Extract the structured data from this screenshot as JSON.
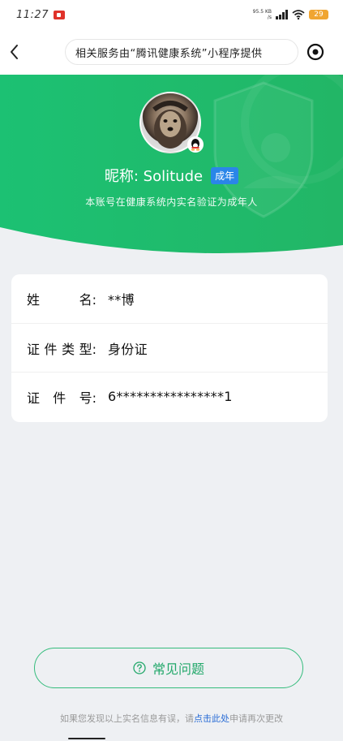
{
  "status_bar": {
    "time": "11:27",
    "net_speed_top": "95.5 KB",
    "net_speed_bottom": "/s",
    "battery": "29"
  },
  "nav": {
    "notice": "相关服务由“腾讯健康系统”小程序提供"
  },
  "profile": {
    "nickname": "昵称: Solitude",
    "badge": "成年",
    "verify_text": "本账号在健康系统内实名验证为成年人"
  },
  "info": {
    "rows": [
      {
        "label": [
          "姓",
          "名:"
        ],
        "value": "**博"
      },
      {
        "label": [
          "证",
          "件",
          "类",
          "型:"
        ],
        "value": "身份证"
      },
      {
        "label": [
          "证",
          "件",
          "号:"
        ],
        "value": "6****************1"
      }
    ]
  },
  "faq": {
    "label": "常见问题"
  },
  "footer": {
    "text_before": "如果您发现以上实名信息有误，请",
    "link": "点击此处",
    "text_after": "申请再次更改"
  },
  "colors": {
    "brand_green": "#1fbf6e",
    "badge_blue": "#2a86e8",
    "link_blue": "#2a6dd6"
  }
}
